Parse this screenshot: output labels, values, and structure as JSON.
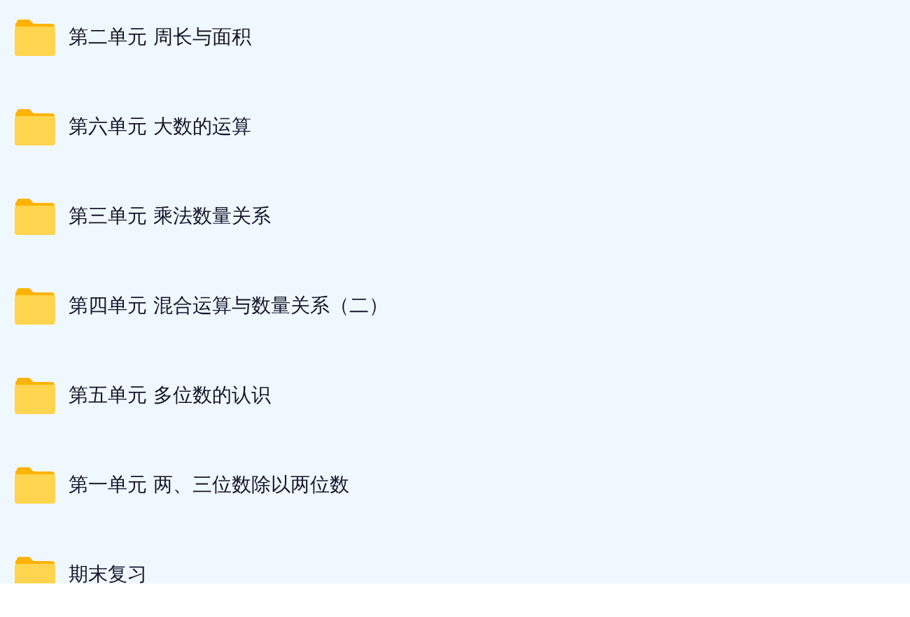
{
  "folders": [
    {
      "name": "第二单元 周长与面积"
    },
    {
      "name": "第六单元 大数的运算"
    },
    {
      "name": "第三单元 乘法数量关系"
    },
    {
      "name": "第四单元 混合运算与数量关系（二）"
    },
    {
      "name": "第五单元 多位数的认识"
    },
    {
      "name": "第一单元 两、三位数除以两位数"
    },
    {
      "name": "期末复习"
    }
  ]
}
